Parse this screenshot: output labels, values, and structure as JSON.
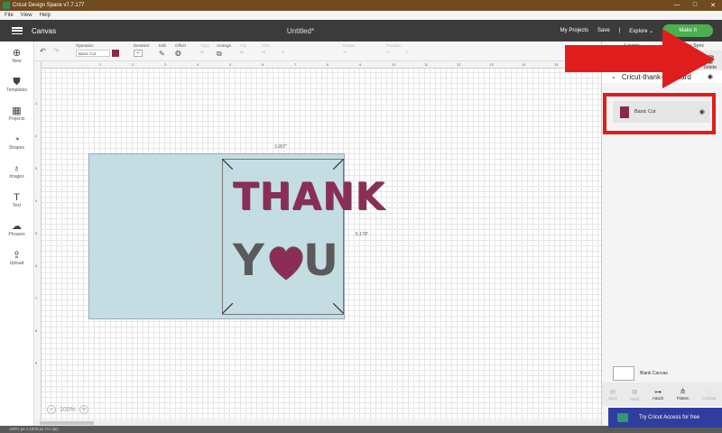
{
  "window": {
    "title": "Cricut Design Space  v7.7.177",
    "controls": [
      "—",
      "□",
      "✕"
    ]
  },
  "menu": [
    "File",
    "View",
    "Help"
  ],
  "header": {
    "section": "Canvas",
    "doc_title": "Untitled*",
    "links": [
      "My Projects",
      "Save",
      "|",
      "Explore ⌄"
    ],
    "make_it": "Make It"
  },
  "leftbar": [
    {
      "label": "New",
      "icon": "plus-icon"
    },
    {
      "label": "Templates",
      "icon": "shirt-icon"
    },
    {
      "label": "Projects",
      "icon": "grid-icon"
    },
    {
      "label": "Shapes",
      "icon": "shapes-icon"
    },
    {
      "label": "Images",
      "icon": "lightbulb-icon"
    },
    {
      "label": "Text",
      "icon": "text-icon"
    },
    {
      "label": "Phrases",
      "icon": "speech-bubble-icon"
    },
    {
      "label": "Upload",
      "icon": "upload-icon"
    }
  ],
  "toolbar": {
    "undo": "↶",
    "redo": "↷",
    "operation_label": "Operation",
    "operation_value": "Basic Cut",
    "deselect": "Deselect",
    "edit": "Edit",
    "offset": "Offset",
    "align": "Align",
    "arrange": "Arrange",
    "flip": "Flip",
    "size": "Size",
    "rotate": "Rotate",
    "position": "Position",
    "operation_color": "#8a2a4a"
  },
  "ruler": {
    "top": [
      "1",
      "2",
      "3",
      "4",
      "5",
      "6",
      "7",
      "8",
      "9",
      "10",
      "11",
      "12",
      "13",
      "14",
      "15",
      "16",
      "17",
      "18"
    ],
    "left": [
      "1",
      "2",
      "3",
      "4",
      "5",
      "6",
      "7",
      "8",
      "9"
    ]
  },
  "canvas": {
    "width_label": "3.957\"",
    "height_label": "5.179\"",
    "word1": "THANK",
    "word2_a": "Y",
    "word2_b": "U",
    "card_color": "#c3dde2",
    "text_color": "#8b2d55"
  },
  "zoom": {
    "minus": "−",
    "value": "100%",
    "plus": "+"
  },
  "status": "100% px  x 1000 px (72 dpi)",
  "panel": {
    "tabs": [
      "Layers",
      "Color Sync"
    ],
    "delete_label": "Delete",
    "group_name": "Cricut-thank-you-card",
    "layer_name": "Basic Cut",
    "layer_color": "#8a2a4a",
    "blank_canvas": "Blank Canvas",
    "actions": [
      "Slice",
      "Weld",
      "Attach",
      "Flatten",
      "Contour"
    ]
  },
  "cta": "Try Cricut Access for free",
  "annotation": {
    "highlight_color": "#e01d1d"
  }
}
